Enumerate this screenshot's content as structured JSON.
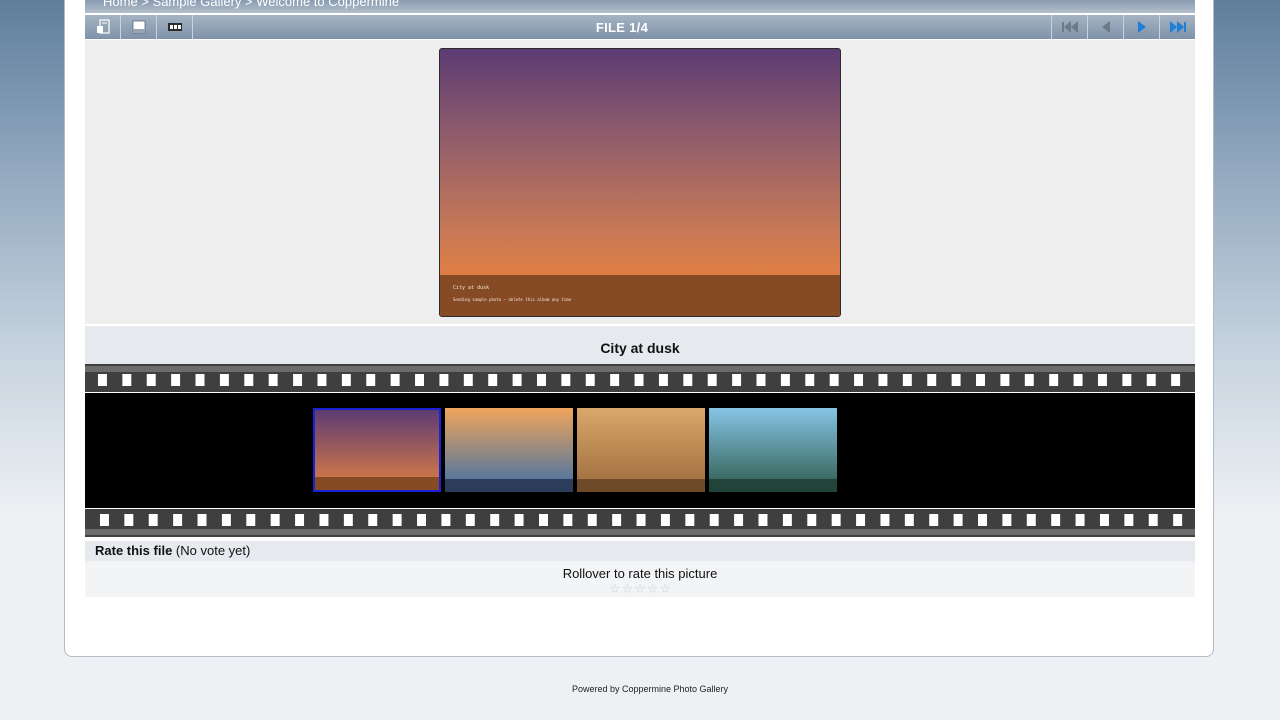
{
  "breadcrumb": {
    "items": [
      "Home",
      "Sample Gallery",
      "Welcome to Coppermine"
    ],
    "separator": ">"
  },
  "toolbar": {
    "title": "FILE 1/4",
    "left_icons": [
      "return-to-thumbnails-icon",
      "file-info-icon",
      "slideshow-icon"
    ],
    "right_icons": [
      "first-file-icon",
      "previous-file-icon",
      "next-file-icon",
      "last-file-icon"
    ]
  },
  "main_image": {
    "overlay_line1": "City at dusk",
    "overlay_line2": "Seeding sample photo — delete this album any time"
  },
  "image_title": "City at dusk",
  "filmstrip": {
    "thumbnails": [
      {
        "gradient_top": "#5c3b73",
        "gradient_bottom": "#e07f44",
        "band": "#864a25",
        "active": true
      },
      {
        "gradient_top": "#f0a55a",
        "gradient_bottom": "#3d6fa8",
        "band": "#2b3d5a",
        "active": false
      },
      {
        "gradient_top": "#d9a86a",
        "gradient_bottom": "#9b6a3c",
        "band": "#6f4a28",
        "active": false
      },
      {
        "gradient_top": "#86c5e5",
        "gradient_bottom": "#2e5a4c",
        "band": "#22433a",
        "active": false
      }
    ]
  },
  "rating": {
    "header_bold": "Rate this file",
    "header_status": "(No vote yet)",
    "prompt": "Rollover to rate this picture",
    "star_count": 5
  },
  "footer": {
    "text": "Powered by Coppermine Photo Gallery"
  },
  "colors": {
    "toolbar_icon": "#ffffff",
    "nav_active_icon": "#1e7fd6",
    "nav_disabled_icon": "#6d7a88"
  }
}
